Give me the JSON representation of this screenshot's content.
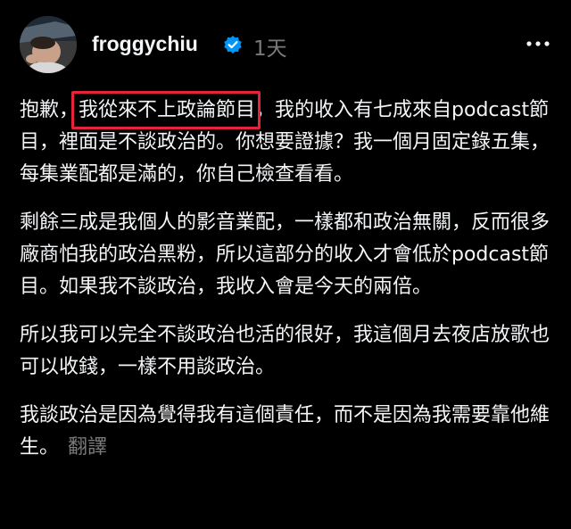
{
  "post": {
    "username": "froggychiu",
    "time": "1天",
    "verified_color": "#0095f6",
    "highlight_color": "#e5233a",
    "icons": {
      "avatar": "profile-photo",
      "verified": "verified-badge-icon",
      "more": "more-horizontal-icon"
    },
    "paragraphs": [
      {
        "before": "抱歉，",
        "highlight": "我從來不上政論節目",
        "after": "，我的收入有七成來自podcast節目，裡面是不談政治的。你想要證據？我一個月固定錄五集，每集業配都是滿的，你自己檢查看看。"
      },
      {
        "text": "剩餘三成是我個人的影音業配，一樣都和政治無關，反而很多廠商怕我的政治黑粉，所以這部分的收入才會低於podcast節目。如果我不談政治，我收入會是今天的兩倍。"
      },
      {
        "text": "所以我可以完全不談政治也活的很好，我這個月去夜店放歌也可以收錢，一樣不用談政治。"
      },
      {
        "text": "我談政治是因為覺得我有這個責任，而不是因為我需要靠他維生。",
        "translate": "翻譯"
      }
    ]
  }
}
